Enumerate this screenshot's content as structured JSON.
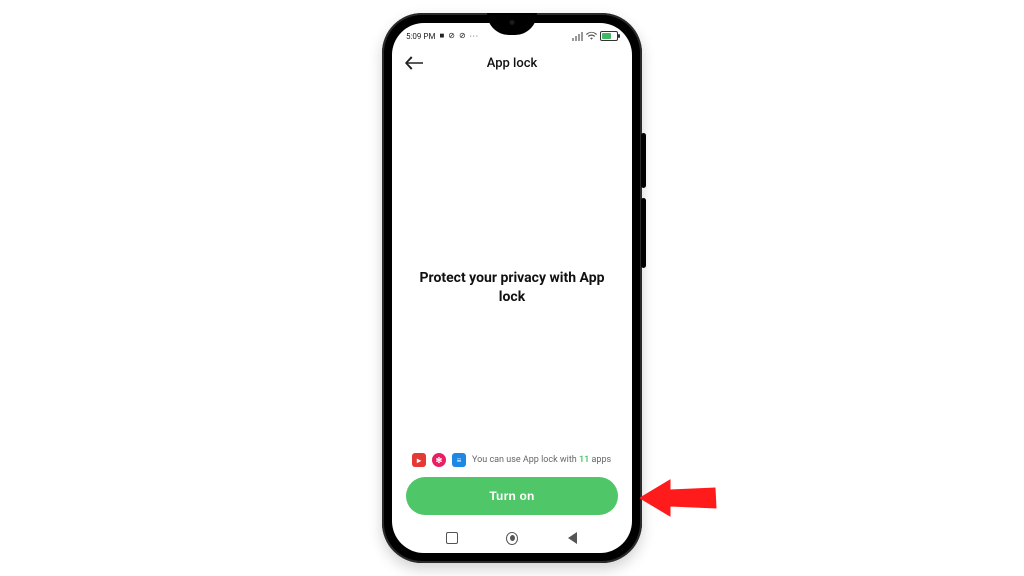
{
  "statusbar": {
    "time": "5:09 PM",
    "icons_left": "■ ⊘ ⊘",
    "dots": "···"
  },
  "header": {
    "title": "App lock"
  },
  "main": {
    "headline": "Protect your privacy with App lock"
  },
  "footer": {
    "apps_text_prefix": "You can use App lock with ",
    "apps_count": "11",
    "apps_text_suffix": " apps",
    "turn_on_label": "Turn on"
  },
  "colors": {
    "accent": "#4fc668"
  }
}
